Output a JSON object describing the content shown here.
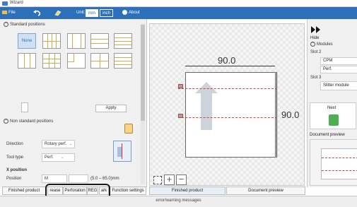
{
  "window": {
    "title": "Wizard"
  },
  "menubar": {
    "file_label": "File",
    "unit_label": "Unit:",
    "unit_mm": "mm",
    "unit_inch": "inch",
    "about_label": "About"
  },
  "left": {
    "standard_positions_header": "Standard positions",
    "none_label": "None",
    "apply_label": "Apply",
    "non_standard_header": "Non standard positions",
    "direction_label": "Direction",
    "direction_value": "Rotary perf.",
    "tool_type_label": "Tool type",
    "tool_type_value": "Perf.",
    "x_position_label": "X position",
    "position_label": "Position",
    "position_value": "M",
    "range_text": "(5.0 – 65.0)mm"
  },
  "tabs": {
    "finished_product": "Finished product",
    "crease_partial": "rease",
    "perforation": "Perforation",
    "reg": "REG",
    "mark_partial": "ark",
    "function_settings": "Function settings"
  },
  "canvas": {
    "width_dim": "90.0",
    "height_dim": "90.0"
  },
  "preview_tabs": {
    "finished_product": "Finished product",
    "document_preview": "Document preview"
  },
  "right": {
    "hide_label": "Hide",
    "modules_header": "Modules",
    "slot2_label": "Slot 2",
    "slot2_item1": "CPM",
    "slot2_item2": "Perf.",
    "slot3_label": "Slot 3",
    "slot3_item": "Slitter module",
    "next_label": "Next",
    "document_preview_label": "Document preview"
  },
  "errors": {
    "label": "error/warning messages"
  },
  "colors": {
    "accent": "#2d6fb8",
    "perf_line": "#e23a3a",
    "highlight_ring": "#1a1a1a"
  }
}
